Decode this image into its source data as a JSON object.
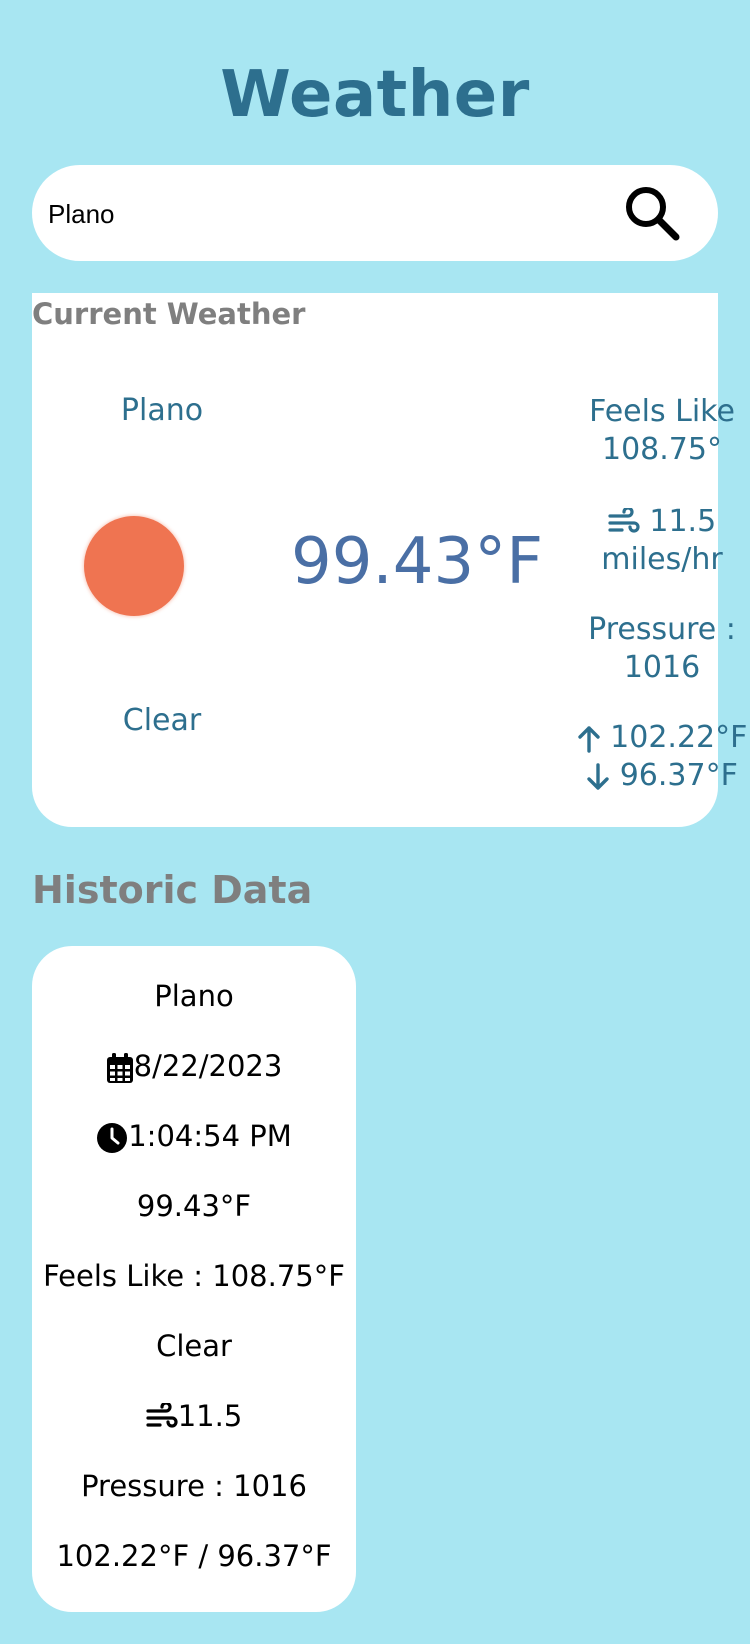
{
  "app": {
    "title": "Weather"
  },
  "search": {
    "value": "Plano",
    "placeholder": "",
    "icon": "search-icon"
  },
  "current": {
    "section_title": "Current Weather",
    "city": "Plano",
    "condition": "Clear",
    "condition_icon": "sun-icon",
    "condition_color": "#ef7451",
    "temperature": "99.43°F",
    "feels_like_label": "Feels Like",
    "feels_like_value": "108.75°",
    "wind_icon": "wind-icon",
    "wind_value": "11.5",
    "wind_unit": "miles/hr",
    "pressure_label": "Pressure :",
    "pressure_value": "1016",
    "max_temp": "102.22°F",
    "min_temp": "96.37°F"
  },
  "historic": {
    "section_title": "Historic Data",
    "entries": [
      {
        "city": "Plano",
        "date": "8/22/2023",
        "time": "1:04:54 PM",
        "temperature": "99.43°F",
        "feels_like": "Feels Like : 108.75°F",
        "condition": "Clear",
        "wind": "11.5",
        "pressure": "Pressure : 1016",
        "range": "102.22°F / 96.37°F"
      }
    ]
  },
  "colors": {
    "background": "#a8e6f2",
    "title": "#2d6f8e",
    "accent_text": "#2d6f8e",
    "temperature": "#4a6fa5",
    "section_heading": "#7f7f7f"
  }
}
